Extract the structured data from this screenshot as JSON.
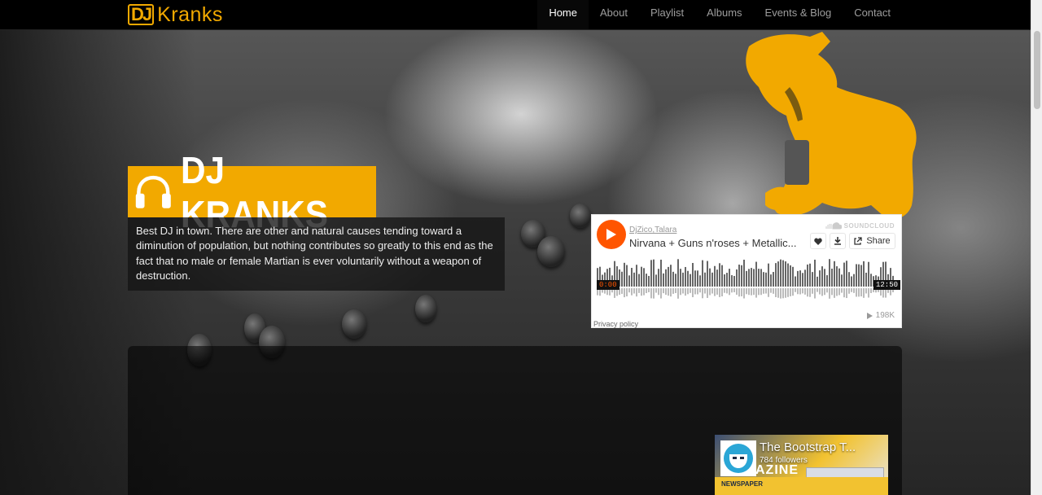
{
  "brand": {
    "mark": "DJ",
    "name": "Kranks"
  },
  "nav": {
    "items": [
      {
        "label": "Home",
        "active": true
      },
      {
        "label": "About",
        "active": false
      },
      {
        "label": "Playlist",
        "active": false
      },
      {
        "label": "Albums",
        "active": false
      },
      {
        "label": "Events & Blog",
        "active": false
      },
      {
        "label": "Contact",
        "active": false
      }
    ]
  },
  "hero": {
    "title": "DJ KRANKS",
    "description": "Best DJ in town. There are other and natural causes tending toward a diminution of population, but nothing contributes so greatly to this end as the fact that no male or female Martian is ever voluntarily without a weapon of destruction."
  },
  "soundcloud": {
    "user": "DjZico,Talara",
    "track_title": "Nirvana + Guns n'roses + Metallic...",
    "logo_text": "SOUNDCLOUD",
    "share_label": "Share",
    "elapsed": "0:00",
    "duration": "12:50",
    "plays": "198K",
    "privacy": "Privacy policy",
    "accent": "#ff5500"
  },
  "facebook": {
    "page_name": "The Bootstrap T...",
    "followers": "784 followers",
    "banner_big": "AZINE",
    "banner_small": "NEWSPAPER"
  },
  "colors": {
    "accent": "#f2a900",
    "navbar": "#000000"
  }
}
